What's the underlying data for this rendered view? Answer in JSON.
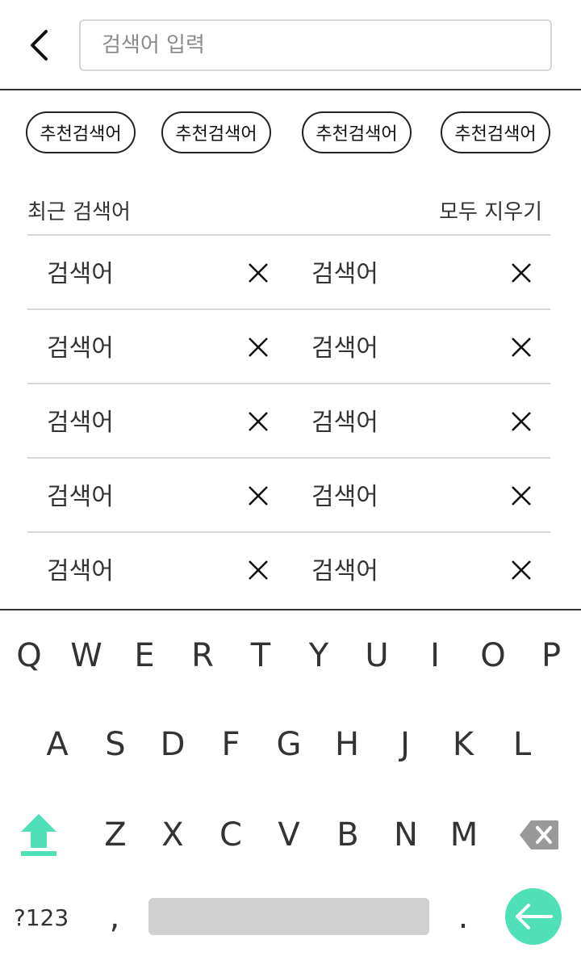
{
  "search": {
    "placeholder": "검색어 입력",
    "value": ""
  },
  "recommended": [
    "추천검색어",
    "추천검색어",
    "추천검색어",
    "추천검색어"
  ],
  "recent": {
    "title": "최근 검색어",
    "clear_all_label": "모두 지우기",
    "rows": [
      [
        "검색어",
        "검색어"
      ],
      [
        "검색어",
        "검색어"
      ],
      [
        "검색어",
        "검색어"
      ],
      [
        "검색어",
        "검색어"
      ],
      [
        "검색어",
        "검색어"
      ]
    ]
  },
  "keyboard": {
    "row1": [
      "Q",
      "W",
      "E",
      "R",
      "T",
      "Y",
      "U",
      "I",
      "O",
      "P"
    ],
    "row2": [
      "A",
      "S",
      "D",
      "F",
      "G",
      "H",
      "J",
      "K",
      "L"
    ],
    "row3": [
      "Z",
      "X",
      "C",
      "V",
      "B",
      "N",
      "M"
    ],
    "symbols_label": "?123",
    "comma": ",",
    "period": ".",
    "shift_icon": "shift-arrow-up-icon",
    "backspace_icon": "backspace-icon",
    "enter_icon": "arrow-left-icon"
  },
  "colors": {
    "accent": "#4fe0b8",
    "border": "#333333",
    "divider": "#d8d8d8",
    "space_bar": "#d0d0d0"
  }
}
